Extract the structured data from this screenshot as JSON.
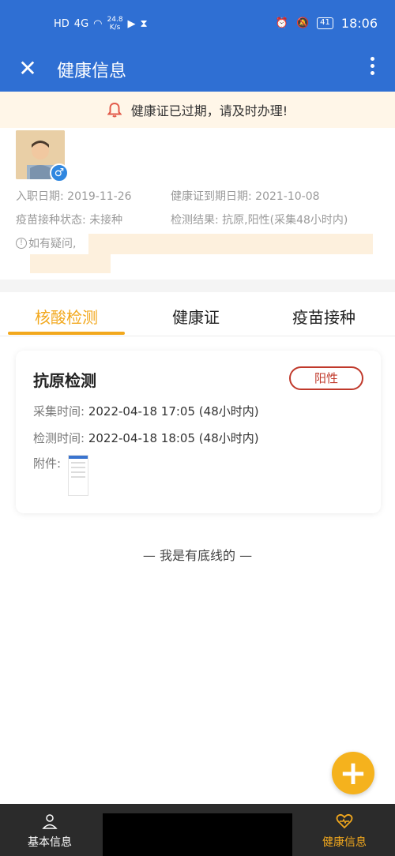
{
  "statusbar": {
    "network_speed_value": "24.8",
    "network_speed_unit": "K/s",
    "time": "18:06",
    "battery": "41",
    "hd_label": "HD",
    "signal_label": "4G"
  },
  "appbar": {
    "title": "健康信息",
    "close_icon": "close-icon",
    "more_icon": "more-vertical-icon"
  },
  "alert": {
    "text": "健康证已过期，请及时办理!",
    "icon": "bell-icon",
    "color": "#e25a4a"
  },
  "profile": {
    "hire_date_label": "入职日期:",
    "hire_date": "2019-11-26",
    "health_cert_expiry_label": "健康证到期日期:",
    "health_cert_expiry": "2021-10-08",
    "vaccine_status_label": "疫苗接种状态:",
    "vaccine_status": "未接种",
    "test_result_label": "检测结果:",
    "test_result": "抗原,阳性(采集48小时内)",
    "note": "如有疑问,",
    "gender_icon": "male-icon"
  },
  "tabs": [
    {
      "label": "核酸检测",
      "active": true
    },
    {
      "label": "健康证",
      "active": false
    },
    {
      "label": "疫苗接种",
      "active": false
    }
  ],
  "card": {
    "title": "抗原检测",
    "result_badge": "阳性",
    "collect_label": "采集时间:",
    "collect_time": "2022-04-18 17:05",
    "collect_note": "(48小时内)",
    "test_label": "检测时间:",
    "test_time": "2022-04-18 18:05",
    "test_note": "(48小时内)",
    "attachment_label": "附件:"
  },
  "footer_text": "— 我是有底线的 —",
  "fab": {
    "icon": "plus-icon",
    "color": "#f5b21d"
  },
  "bottom_nav": [
    {
      "label": "基本信息",
      "icon": "person-icon",
      "active": false
    },
    {
      "label": "健康信息",
      "icon": "heart-pulse-icon",
      "active": true
    }
  ],
  "colors": {
    "primary_blue": "#2f6fd3",
    "accent_orange": "#f2a81d",
    "positive_red": "#c0392b"
  }
}
